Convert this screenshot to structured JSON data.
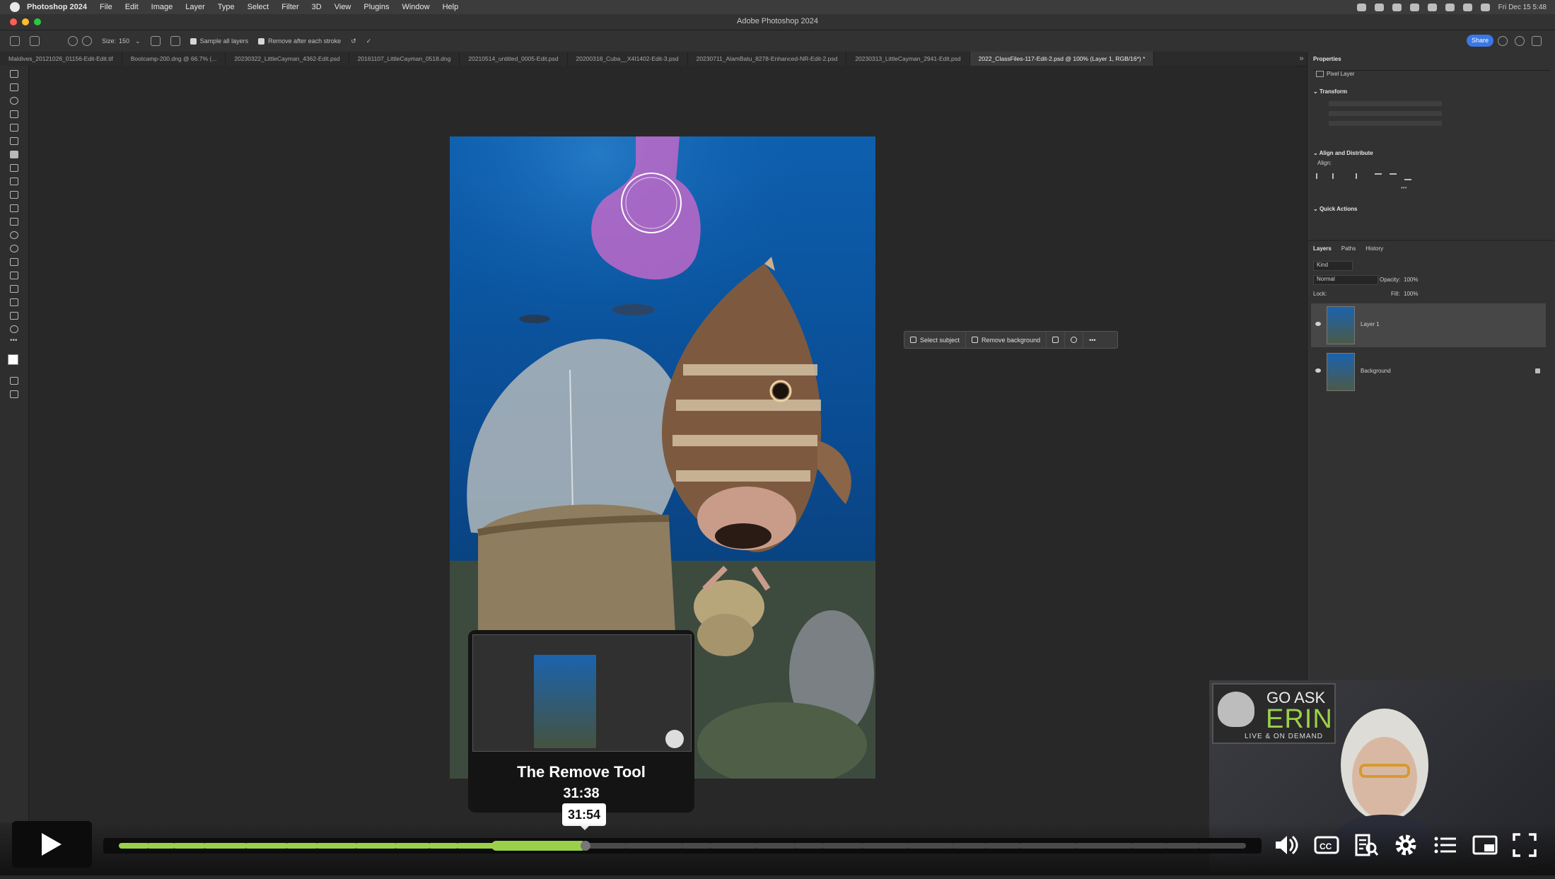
{
  "menubar": {
    "app": "Photoshop 2024",
    "items": [
      "File",
      "Edit",
      "Image",
      "Layer",
      "Type",
      "Select",
      "Filter",
      "3D",
      "View",
      "Plugins",
      "Window",
      "Help"
    ],
    "clock": "Fri Dec 15  5:48"
  },
  "window": {
    "title": "Adobe Photoshop 2024"
  },
  "options": {
    "size_label": "Size:",
    "size_value": "150",
    "sample_all_layers": "Sample all layers",
    "remove_after_stroke": "Remove after each stroke",
    "share": "Share"
  },
  "tabs": [
    {
      "label": "Maldives_20121026_01156-Edit-Edit.tif"
    },
    {
      "label": "Bootcamp-200.dng @ 66.7% (..."
    },
    {
      "label": "20230322_LittleCayman_4362-Edit.psd"
    },
    {
      "label": "20161107_LittleCayman_0518.dng"
    },
    {
      "label": "20210514_untitled_0005-Edit.psd"
    },
    {
      "label": "20200318_Cuba__X4I1402-Edit-3.psd"
    },
    {
      "label": "20230711_AlamBatu_8278-Enhanced-NR-Edit-2.psd"
    },
    {
      "label": "20230313_LittleCayman_2941-Edit.psd"
    },
    {
      "label": "2022_ClassFiles-117-Edit-2.psd @ 100% (Layer 1, RGB/16*) *"
    }
  ],
  "context_bar": {
    "select_subject": "Select subject",
    "remove_background": "Remove background"
  },
  "properties": {
    "title": "Properties",
    "pixel_layer": "Pixel Layer",
    "transform": "Transform",
    "align_distribute": "Align and Distribute",
    "align": "Align:",
    "quick_actions": "Quick Actions"
  },
  "layers_panel": {
    "tabs": [
      "Layers",
      "Paths",
      "History"
    ],
    "kind": "Kind",
    "blend": "Normal",
    "opacity_label": "Opacity:",
    "opacity": "100%",
    "lock_label": "Lock:",
    "fill_label": "Fill:",
    "fill": "100%",
    "layers": [
      {
        "name": "Layer 1"
      },
      {
        "name": "Background"
      }
    ]
  },
  "video": {
    "chapter_title": "The Remove Tool",
    "chapter_time": "31:38",
    "hover_time": "31:54",
    "progress_fraction": 0.41,
    "played_color": "#9bd14a"
  },
  "webcam": {
    "logo_line1": "GO ASK",
    "logo_line2": "ERIN",
    "logo_tagline": "LIVE & ON DEMAND"
  }
}
